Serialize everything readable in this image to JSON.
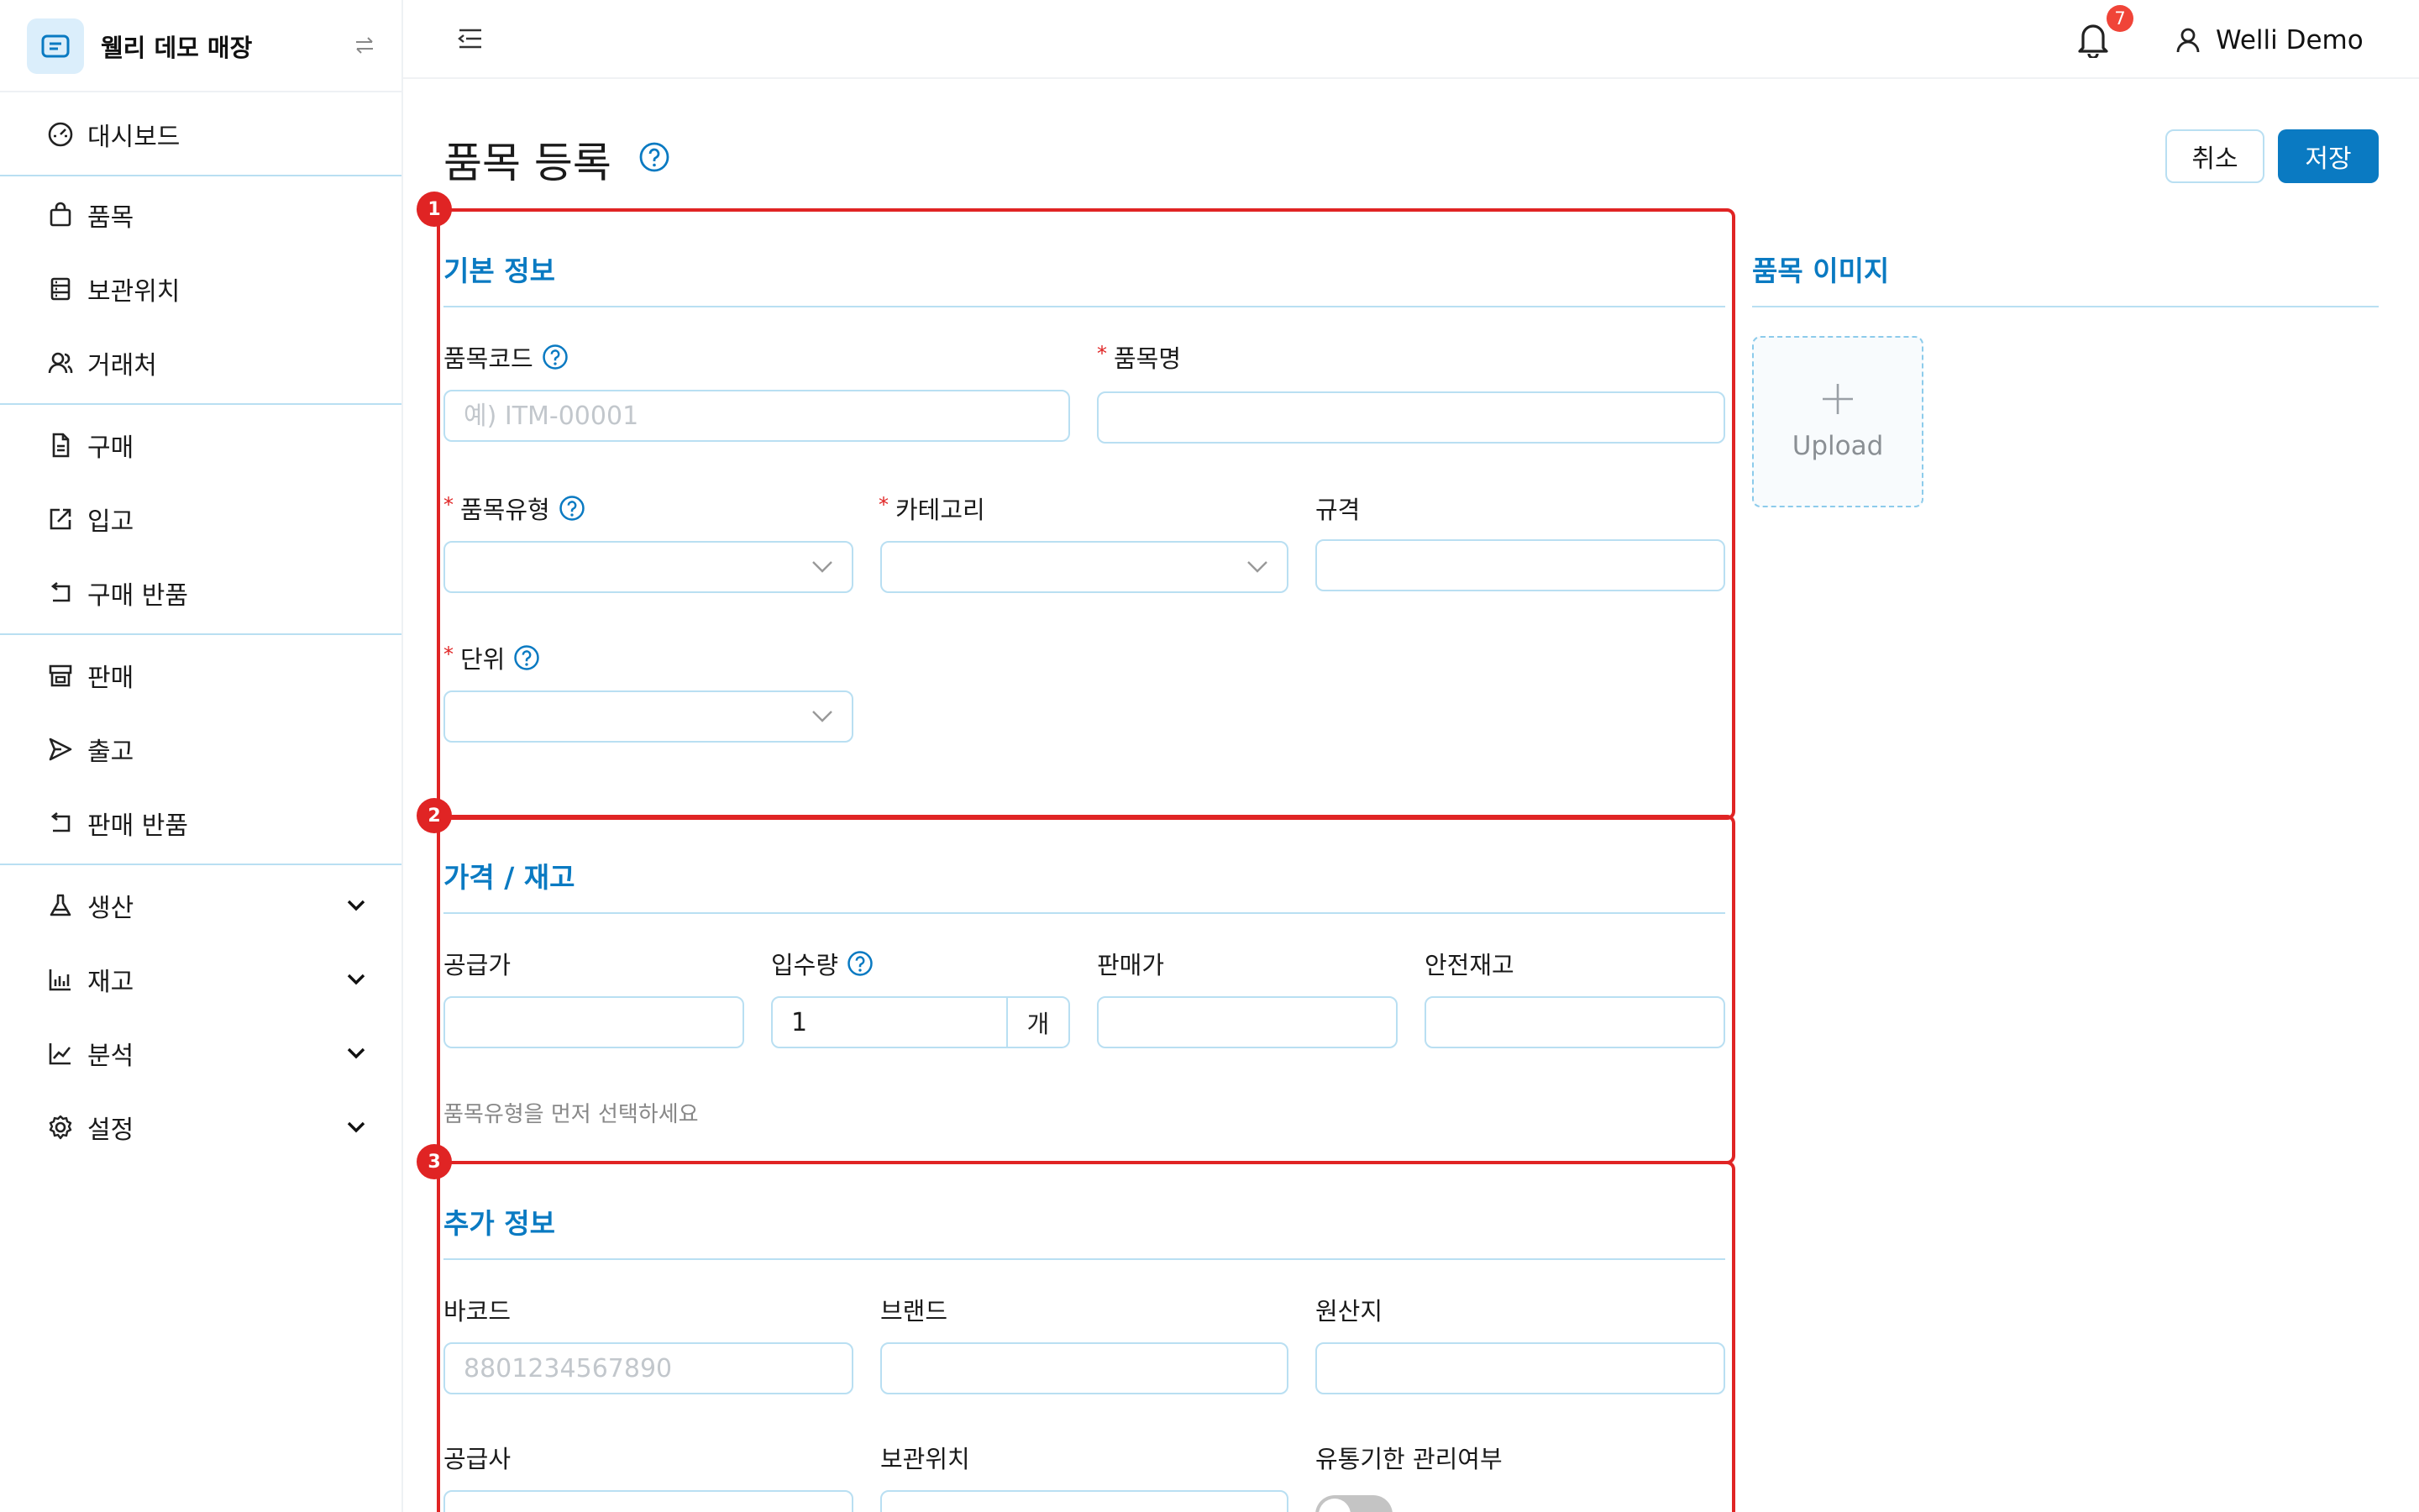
{
  "brand": {
    "name": "웰리 데모 매장",
    "logo_icon": "receipt-icon",
    "toggle_icon": "switch-arrows-icon"
  },
  "sidebar": {
    "items": [
      {
        "label": "대시보드",
        "icon": "gauge-icon"
      },
      {
        "label": "품목",
        "icon": "shopping-bag-icon"
      },
      {
        "label": "보관위치",
        "icon": "storage-icon"
      },
      {
        "label": "거래처",
        "icon": "users-icon"
      },
      {
        "label": "구매",
        "icon": "document-icon"
      },
      {
        "label": "입고",
        "icon": "edit-box-icon"
      },
      {
        "label": "구매 반품",
        "icon": "return-icon"
      },
      {
        "label": "판매",
        "icon": "store-icon"
      },
      {
        "label": "출고",
        "icon": "send-icon"
      },
      {
        "label": "판매 반품",
        "icon": "return-icon"
      },
      {
        "label": "생산",
        "icon": "flask-icon",
        "expandable": true
      },
      {
        "label": "재고",
        "icon": "bar-chart-icon",
        "expandable": true
      },
      {
        "label": "분석",
        "icon": "line-chart-icon",
        "expandable": true
      },
      {
        "label": "설정",
        "icon": "gear-icon",
        "expandable": true
      }
    ]
  },
  "topbar": {
    "notification_count": "7",
    "user_name": "Welli Demo"
  },
  "page": {
    "title": "품목 등록",
    "cancel_label": "취소",
    "save_label": "저장"
  },
  "markers": [
    "1",
    "2",
    "3"
  ],
  "basic": {
    "title": "기본 정보",
    "item_code": {
      "label": "품목코드",
      "placeholder": "예) ITM-00001",
      "value": ""
    },
    "item_name": {
      "label": "품목명",
      "required": true,
      "value": ""
    },
    "item_type": {
      "label": "품목유형",
      "required": true,
      "value": ""
    },
    "category": {
      "label": "카테고리",
      "required": true,
      "value": ""
    },
    "spec": {
      "label": "규격",
      "value": ""
    },
    "unit": {
      "label": "단위",
      "required": true,
      "value": ""
    }
  },
  "price": {
    "title": "가격 / 재고",
    "supply_price": {
      "label": "공급가",
      "value": ""
    },
    "inbound_qty": {
      "label": "입수량",
      "value": "1",
      "suffix": "개"
    },
    "sale_price": {
      "label": "판매가",
      "value": ""
    },
    "safety_stock": {
      "label": "안전재고",
      "value": ""
    },
    "hint": "품목유형을 먼저 선택하세요"
  },
  "extra": {
    "title": "추가 정보",
    "barcode": {
      "label": "바코드",
      "placeholder": "8801234567890",
      "value": ""
    },
    "brand": {
      "label": "브랜드",
      "value": ""
    },
    "origin": {
      "label": "원산지",
      "value": ""
    },
    "supplier": {
      "label": "공급사",
      "value": ""
    },
    "location": {
      "label": "보관위치",
      "value": ""
    },
    "expiry": {
      "label": "유통기한 관리여부",
      "enabled": false
    }
  },
  "image_panel": {
    "title": "품목 이미지",
    "upload_label": "Upload"
  }
}
